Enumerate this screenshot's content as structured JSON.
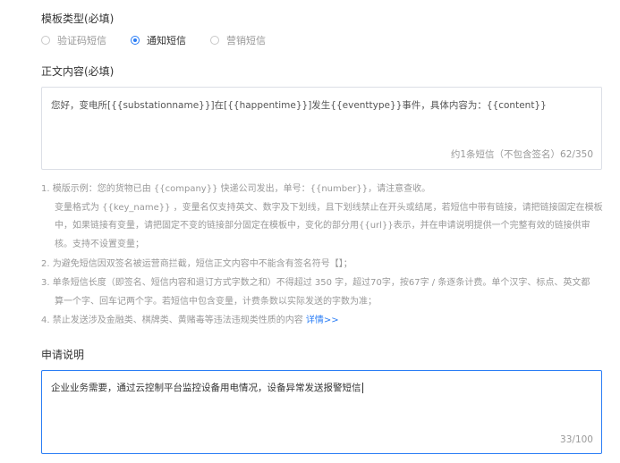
{
  "template_type": {
    "title": "模板类型(必填)",
    "options": [
      {
        "label": "验证码短信",
        "checked": false
      },
      {
        "label": "通知短信",
        "checked": true
      },
      {
        "label": "营销短信",
        "checked": false
      }
    ]
  },
  "body_content": {
    "title": "正文内容(必填)",
    "value": "您好，变电所[{{substationname}}]在[{{happentime}}]发生{{eventtype}}事件，具体内容为：{{content}}",
    "counter": "约1条短信（不包含签名）62/350"
  },
  "notes": {
    "lines": [
      "1. 模版示例：您的货物已由 {{company}} 快递公司发出，单号：{{number}}，请注意查收。",
      "变量格式为 {{key_name}} ，变量名仅支持英文、数字及下划线，且下划线禁止在开头或结尾，若短信中带有链接，请把链接固定在模板",
      "中，如果链接有变量，请把固定不变的链接部分固定在模板中，变化的部分用{{url}}表示，并在申请说明提供一个完整有效的链接供审",
      "核。支持不设置变量；",
      "2. 为避免短信因双签名被运营商拦截，短信正文内容中不能含有签名符号【】；",
      "3. 单条短信长度（即签名、短信内容和退订方式字数之和）不得超过 350 字，超过70字，按67字 / 条逐条计费。单个汉字、标点、英文都",
      "算一个字、回车记两个字。若短信中包含变量，计费条数以实际发送的字数为准；",
      "4. 禁止发送涉及金融类、棋牌类、黄赌毒等违法违规类性质的内容 "
    ],
    "details_link": "详情>>"
  },
  "application_note": {
    "title": "申请说明",
    "value": "企业业务需要，通过云控制平台监控设备用电情况，设备异常发送报警短信",
    "counter": "33/100"
  },
  "colors": {
    "accent": "#2a7df5",
    "muted_text": "#999999",
    "border": "#dcdfe6"
  }
}
